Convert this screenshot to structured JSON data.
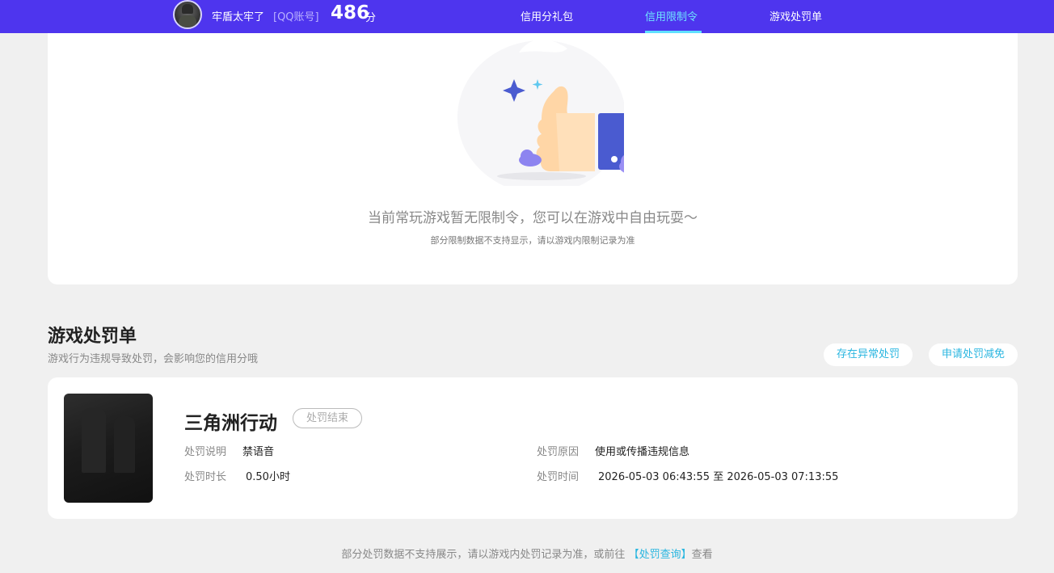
{
  "user": {
    "name": "牢盾太牢了",
    "account_type": "[QQ账号]",
    "score": "486",
    "score_unit": "分"
  },
  "nav": {
    "tabs": [
      {
        "label": "信用分礼包",
        "active": false
      },
      {
        "label": "信用限制令",
        "active": true
      },
      {
        "label": "游戏处罚单",
        "active": false
      }
    ]
  },
  "restriction": {
    "empty_title": "当前常玩游戏暂无限制令，您可以在游戏中自由玩耍～",
    "empty_sub": "部分限制数据不支持显示，请以游戏内限制记录为准"
  },
  "penalty_section": {
    "title": "游戏处罚单",
    "desc": "游戏行为违规导致处罚，会影响您的信用分哦",
    "btn_abnormal": "存在异常处罚",
    "btn_reduce": "申请处罚减免"
  },
  "penalty": {
    "game_name": "三角洲行动",
    "status": "处罚结束",
    "desc_label": "处罚说明",
    "desc_value": "禁语音",
    "reason_label": "处罚原因",
    "reason_value": "使用或传播违规信息",
    "duration_label": "处罚时长",
    "duration_value": "0.50小时",
    "time_label": "处罚时间",
    "time_value": "2026-05-03 06:43:55 至 2026-05-03 07:13:55"
  },
  "footer": {
    "prefix": "部分处罚数据不支持展示，请以游戏内处罚记录为准，或前往",
    "link": "【处罚查询】",
    "suffix": "查看"
  },
  "colors": {
    "topbar": "#4e35ee",
    "accent_cyan": "#2ab6e0",
    "active_tab": "#6ee4ff"
  }
}
